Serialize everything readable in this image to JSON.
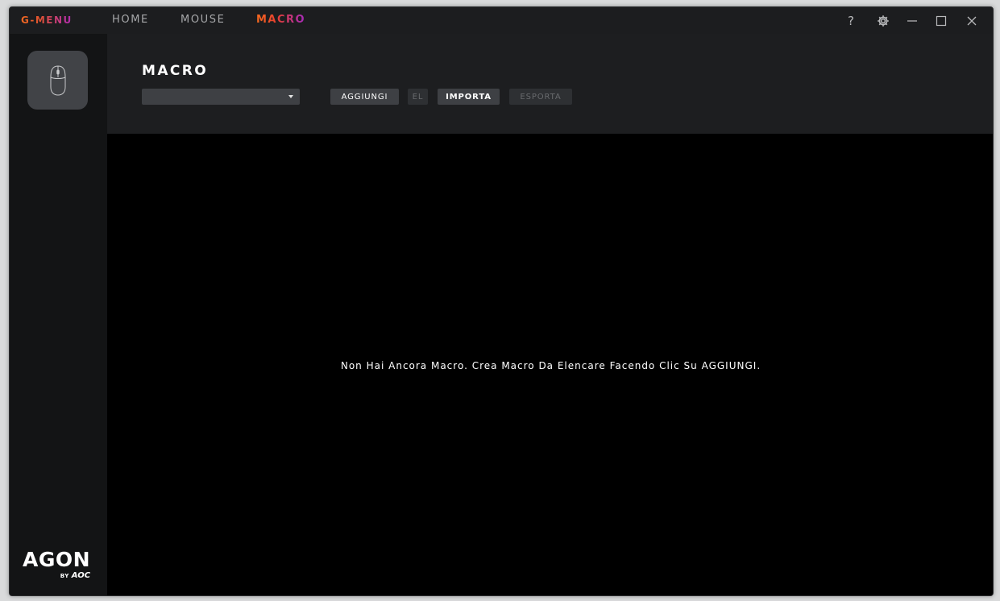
{
  "app": {
    "logo": "G-MENU"
  },
  "nav": {
    "tabs": [
      {
        "label": "HOME",
        "active": false
      },
      {
        "label": "MOUSE",
        "active": false
      },
      {
        "label": "MACRO",
        "active": true
      }
    ]
  },
  "window_controls": {
    "help_label": "?",
    "icons": [
      "gear-icon",
      "minimize-icon",
      "maximize-icon",
      "close-icon"
    ]
  },
  "sidebar": {
    "device_icon": "mouse-icon",
    "brand_main": "AGON",
    "brand_by": "BY",
    "brand_aoc": "AOC"
  },
  "header": {
    "title": "MACRO",
    "select_value": "",
    "buttons": {
      "add": "AGGIUNGI",
      "delete": "EL",
      "import": "IMPORTA",
      "export": "ESPORTA"
    }
  },
  "main": {
    "empty_message": "Non Hai Ancora Macro. Crea Macro Da Elencare Facendo Clic Su AGGIUNGI."
  },
  "colors": {
    "accent_orange": "#f26a21",
    "accent_purple": "#b02ab6",
    "panel": "#1d1e20",
    "sidebar": "#131415",
    "content": "#000000"
  }
}
